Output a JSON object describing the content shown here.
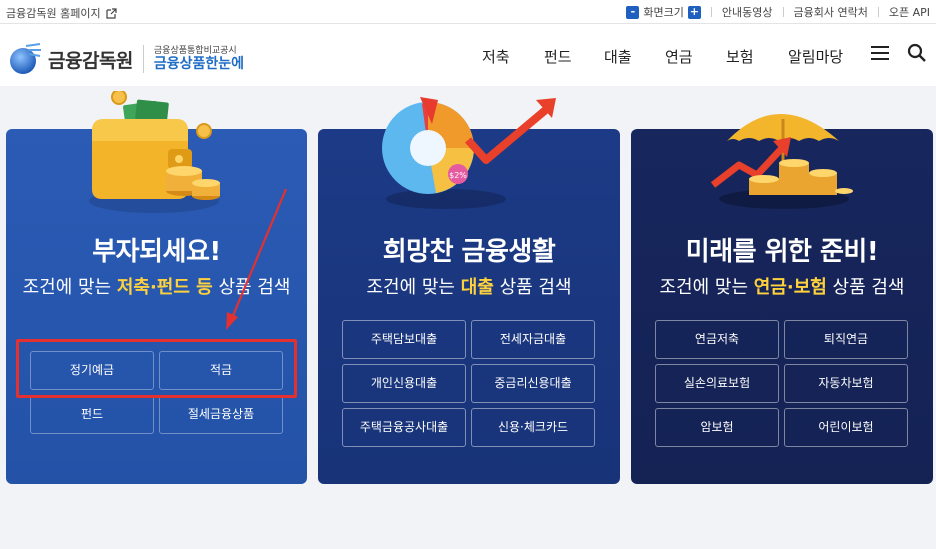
{
  "topbar": {
    "home_label": "금융감독원 홈페이지",
    "zoom_label": "화면크기",
    "zoom_minus": "-",
    "zoom_plus": "+",
    "links": [
      "안내동영상",
      "금융회사 연락처",
      "오픈 API"
    ]
  },
  "header": {
    "logo_text": "금융감독원",
    "sub_line1": "금융상품통합비교공시",
    "sub_line2": "금융상품한눈에",
    "nav": [
      "저축",
      "펀드",
      "대출",
      "연금",
      "보험",
      "알림마당"
    ]
  },
  "panels": [
    {
      "title": "부자되세요!",
      "desc_pre": "조건에 맞는 ",
      "desc_highlight": "저축·펀드 등",
      "desc_post": " 상품 검색",
      "buttons": [
        "정기예금",
        "적금",
        "펀드",
        "절세금융상품"
      ]
    },
    {
      "title": "희망찬 금융생활",
      "desc_pre": "조건에 맞는 ",
      "desc_highlight": "대출",
      "desc_post": " 상품 검색",
      "badge": "$2%",
      "buttons": [
        "주택담보대출",
        "전세자금대출",
        "개인신용대출",
        "중금리신용대출",
        "주택금융공사대출",
        "신용·체크카드"
      ]
    },
    {
      "title": "미래를 위한 준비!",
      "desc_pre": "조건에 맞는 ",
      "desc_highlight": "연금·보험",
      "desc_post": " 상품 검색",
      "buttons": [
        "연금저축",
        "퇴직연금",
        "실손의료보험",
        "자동차보험",
        "암보험",
        "어린이보험"
      ]
    }
  ],
  "colors": {
    "highlight": "#ffd23d",
    "annotation": "#e53030",
    "brand_blue": "#1f6dc6"
  }
}
